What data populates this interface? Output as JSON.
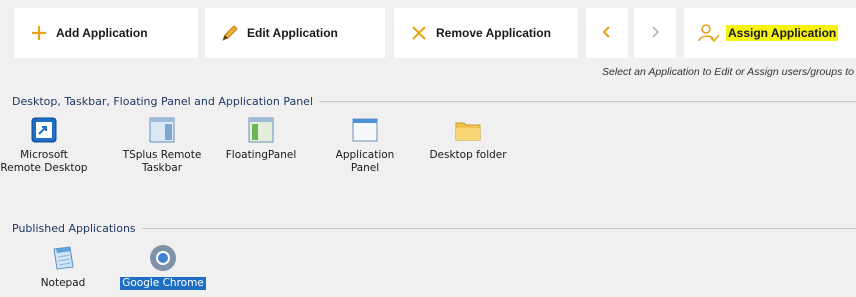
{
  "toolbar": {
    "add_label": "Add Application",
    "edit_label": "Edit Application",
    "remove_label": "Remove Application",
    "assign_label": "Assign Application",
    "back_icon": "chevron-left-icon",
    "forward_icon": "chevron-right-icon",
    "accent_color": "#e8a317",
    "highlight_color": "#f7f311"
  },
  "hint_text": "Select an Application to Edit or Assign users/groups to",
  "groups": [
    {
      "title": "Desktop, Taskbar, Floating Panel and Application Panel",
      "items": [
        {
          "label": "Microsoft\nRemote Desktop",
          "icon": "remote-desktop-icon"
        },
        {
          "label": "TSplus Remote\nTaskbar",
          "icon": "taskbar-icon"
        },
        {
          "label": "FloatingPanel",
          "icon": "floating-panel-icon"
        },
        {
          "label": "Application\nPanel",
          "icon": "application-panel-icon"
        },
        {
          "label": "Desktop folder",
          "icon": "folder-icon"
        }
      ]
    },
    {
      "title": "Published Applications",
      "items": [
        {
          "label": "Notepad",
          "icon": "notepad-icon"
        },
        {
          "label": "Google Chrome",
          "icon": "chrome-icon",
          "selected": true
        }
      ]
    }
  ]
}
